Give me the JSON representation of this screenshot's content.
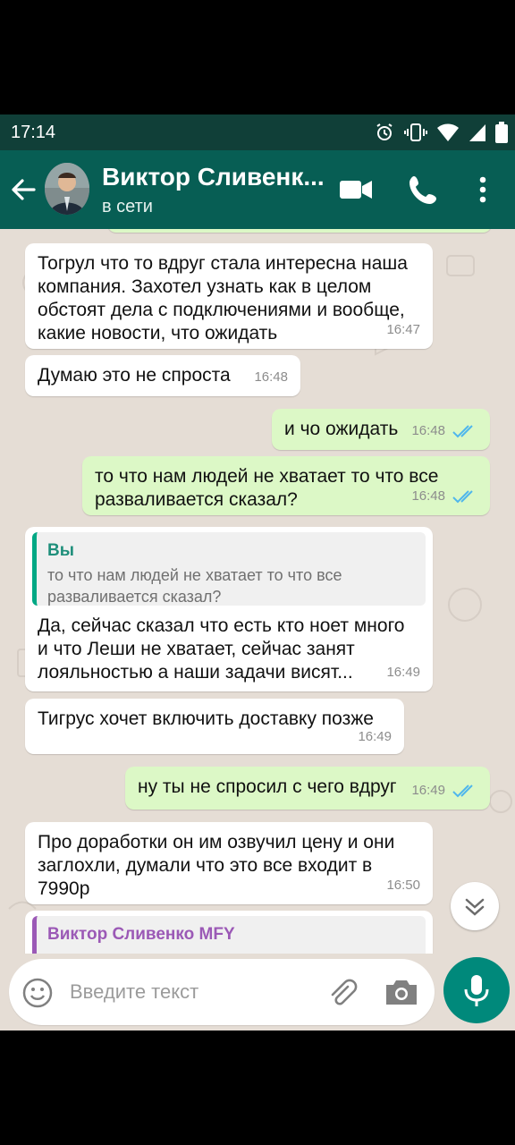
{
  "status": {
    "time": "17:14"
  },
  "header": {
    "name": "Виктор Сливенк...",
    "presence": "в сети"
  },
  "messages": [
    {
      "text": "Тогрул что то вдруг стала интересна наша\nкомпания.  Захотел узнать как в целом\nобстоят дела с подключениями и вообще,\nкакие новости, что ожидать",
      "time": "16:47"
    },
    {
      "text": "Думаю это не спроста",
      "time": "16:48"
    },
    {
      "text": "и чо ожидать",
      "time": "16:48"
    },
    {
      "text": "то что нам людей не хватает то что все\nразваливается сказал?",
      "time": "16:48"
    },
    {
      "quote_name": "Вы",
      "quote_text": "то что нам людей не хватает то что все\nразваливается сказал?",
      "text": "Да, сейчас сказал что есть кто ноет много\nи что Леши не хватает, сейчас занят\nлояльностью а наши задачи висят...",
      "time": "16:49"
    },
    {
      "text": "Тигрус хочет включить доставку позже",
      "time": "16:49"
    },
    {
      "text": "ну ты не спросил с чего вдруг",
      "time": "16:49"
    },
    {
      "text": "Про доработки он им озвучил цену и они\nзаглохли, думали что это все входит в\n7990р",
      "time": "16:50"
    },
    {
      "quote_name": "Виктор Сливенко MFY"
    }
  ],
  "input": {
    "placeholder": "Введите текст"
  },
  "colors": {
    "header": "#075e54",
    "incoming": "#ffffff",
    "outgoing": "#dcf8c6",
    "accent": "#00897b"
  }
}
